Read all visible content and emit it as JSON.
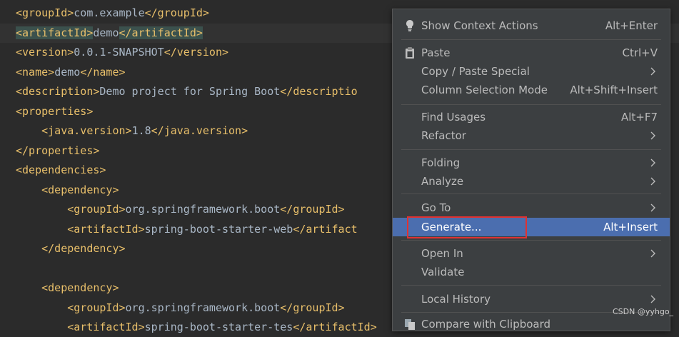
{
  "editor": {
    "lines": [
      {
        "indent": "",
        "parts": [
          [
            "<groupId>",
            "tag"
          ],
          [
            "com.example",
            "txt"
          ],
          [
            "</groupId>",
            "tag"
          ]
        ]
      },
      {
        "indent": "",
        "highlight": true,
        "parts": [
          [
            "<artifactId>",
            "tag hlt"
          ],
          [
            "demo",
            "txt"
          ],
          [
            "</artifactId>",
            "tag hlt"
          ]
        ]
      },
      {
        "indent": "",
        "parts": [
          [
            "<version>",
            "tag"
          ],
          [
            "0.0.1-SNAPSHOT",
            "txt"
          ],
          [
            "</version>",
            "tag"
          ]
        ]
      },
      {
        "indent": "",
        "parts": [
          [
            "<name>",
            "tag"
          ],
          [
            "demo",
            "txt"
          ],
          [
            "</name>",
            "tag"
          ]
        ]
      },
      {
        "indent": "",
        "parts": [
          [
            "<description>",
            "tag"
          ],
          [
            "Demo project for Spring Boot",
            "txt"
          ],
          [
            "</descriptio",
            "tag"
          ]
        ]
      },
      {
        "indent": "",
        "parts": [
          [
            "<properties>",
            "tag"
          ]
        ]
      },
      {
        "indent": "    ",
        "parts": [
          [
            "<java.version>",
            "tag"
          ],
          [
            "1.8",
            "txt"
          ],
          [
            "</java.version>",
            "tag"
          ]
        ]
      },
      {
        "indent": "",
        "parts": [
          [
            "</properties>",
            "tag"
          ]
        ]
      },
      {
        "indent": "",
        "parts": [
          [
            "<dependencies>",
            "tag"
          ]
        ]
      },
      {
        "indent": "    ",
        "parts": [
          [
            "<dependency>",
            "tag"
          ]
        ]
      },
      {
        "indent": "        ",
        "parts": [
          [
            "<groupId>",
            "tag"
          ],
          [
            "org.springframework.boot",
            "txt"
          ],
          [
            "</groupId>",
            "tag"
          ]
        ]
      },
      {
        "indent": "        ",
        "parts": [
          [
            "<artifactId>",
            "tag"
          ],
          [
            "spring-boot-starter-web",
            "txt"
          ],
          [
            "</artifact",
            "tag"
          ]
        ]
      },
      {
        "indent": "    ",
        "parts": [
          [
            "</dependency>",
            "tag"
          ]
        ]
      },
      {
        "indent": "",
        "parts": []
      },
      {
        "indent": "    ",
        "parts": [
          [
            "<dependency>",
            "tag"
          ]
        ]
      },
      {
        "indent": "        ",
        "parts": [
          [
            "<groupId>",
            "tag"
          ],
          [
            "org.springframework.boot",
            "txt"
          ],
          [
            "</groupId>",
            "tag"
          ]
        ]
      },
      {
        "indent": "        ",
        "parts": [
          [
            "<artifactId>",
            "tag"
          ],
          [
            "spring-boot-starter-tes",
            "txt"
          ],
          [
            "</artifactId>",
            "tag"
          ]
        ]
      }
    ]
  },
  "context_menu": {
    "items": [
      {
        "label": "Show Context Actions",
        "shortcut": "Alt+Enter",
        "icon": "lightbulb-icon"
      },
      {
        "label": "Paste",
        "shortcut": "Ctrl+V",
        "icon": "clipboard-icon"
      },
      {
        "label": "Copy / Paste Special",
        "shortcut": "",
        "submenu": true
      },
      {
        "label": "Column Selection Mode",
        "shortcut": "Alt+Shift+Insert"
      },
      {
        "label": "Find Usages",
        "shortcut": "Alt+F7"
      },
      {
        "label": "Refactor",
        "shortcut": "",
        "submenu": true
      },
      {
        "label": "Folding",
        "shortcut": "",
        "submenu": true
      },
      {
        "label": "Analyze",
        "shortcut": "",
        "submenu": true
      },
      {
        "label": "Go To",
        "shortcut": "",
        "submenu": true
      },
      {
        "label": "Generate...",
        "shortcut": "Alt+Insert",
        "selected": true
      },
      {
        "label": "Open In",
        "shortcut": "",
        "submenu": true
      },
      {
        "label": "Validate",
        "shortcut": ""
      },
      {
        "label": "Local History",
        "shortcut": "",
        "submenu": true
      },
      {
        "label": "Compare with Clipboard",
        "shortcut": "",
        "icon": "compare-icon"
      }
    ]
  },
  "watermark": "CSDN @yyhgo_",
  "colors": {
    "editor_bg": "#2b2b2b",
    "menu_bg": "#3c3f41",
    "selection": "#4b6eaf",
    "tag": "#e8bf6a",
    "annotation_box": "#e03232"
  }
}
